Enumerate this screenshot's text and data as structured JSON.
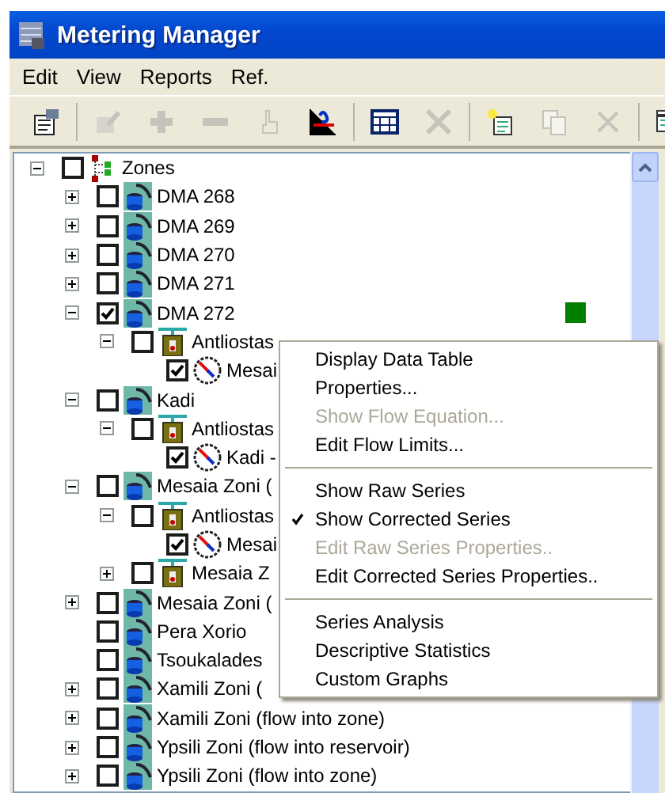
{
  "window": {
    "title": "Metering Manager"
  },
  "menu_bar": [
    {
      "label": "Edit"
    },
    {
      "label": "View"
    },
    {
      "label": "Reports"
    },
    {
      "label": "Ref."
    }
  ],
  "toolbar": {
    "groups": [
      [
        {
          "kind": "properties",
          "disabled": false
        }
      ],
      [
        {
          "kind": "edit-chart",
          "disabled": true
        },
        {
          "kind": "plus",
          "disabled": true
        },
        {
          "kind": "minus",
          "disabled": true
        },
        {
          "kind": "pointer",
          "disabled": true
        },
        {
          "kind": "chart-query",
          "disabled": false
        }
      ],
      [
        {
          "kind": "table",
          "disabled": false
        },
        {
          "kind": "cross-chart",
          "disabled": true
        }
      ],
      [
        {
          "kind": "new-sheet",
          "disabled": false
        },
        {
          "kind": "copy",
          "disabled": true
        },
        {
          "kind": "delete",
          "disabled": true
        }
      ],
      [
        {
          "kind": "calendar-globe",
          "disabled": false
        }
      ]
    ]
  },
  "tree": {
    "label": "Zones",
    "kind": "root",
    "checked": false,
    "expanded": true,
    "children": [
      {
        "label": "DMA 268",
        "kind": "zone",
        "checked": false,
        "expanded": false
      },
      {
        "label": "DMA 269",
        "kind": "zone",
        "checked": false,
        "expanded": false
      },
      {
        "label": "DMA 270",
        "kind": "zone",
        "checked": false,
        "expanded": false
      },
      {
        "label": "DMA 271",
        "kind": "zone",
        "checked": false,
        "expanded": false
      },
      {
        "label": "DMA 272",
        "kind": "zone",
        "checked": true,
        "expanded": true,
        "color": "#008000",
        "children": [
          {
            "label": "Antliostas",
            "kind": "station",
            "checked": false,
            "expanded": true,
            "children": [
              {
                "label": "Mesai",
                "kind": "meter",
                "checked": true
              }
            ]
          }
        ]
      },
      {
        "label": "Kadi",
        "kind": "zone",
        "checked": false,
        "expanded": true,
        "children": [
          {
            "label": "Antliostas",
            "kind": "station",
            "checked": false,
            "expanded": true,
            "children": [
              {
                "label": "Kadi -",
                "kind": "meter",
                "checked": true
              }
            ]
          }
        ]
      },
      {
        "label": "Mesaia Zoni (",
        "kind": "zone",
        "checked": false,
        "expanded": true,
        "children": [
          {
            "label": "Antliostas",
            "kind": "station",
            "checked": false,
            "expanded": true,
            "children": [
              {
                "label": "Mesai",
                "kind": "meter",
                "checked": true
              }
            ]
          },
          {
            "label": "Mesaia Z",
            "kind": "station",
            "checked": false,
            "expanded": false
          }
        ]
      },
      {
        "label": "Mesaia Zoni (",
        "kind": "zone",
        "checked": false,
        "expanded": false
      },
      {
        "label": "Pera Xorio",
        "kind": "zone",
        "checked": false
      },
      {
        "label": "Tsoukalades",
        "kind": "zone",
        "checked": false
      },
      {
        "label": "Xamili Zoni (",
        "kind": "zone",
        "checked": false,
        "expanded": false
      },
      {
        "label": "Xamili Zoni (flow into zone)",
        "kind": "zone",
        "checked": false,
        "expanded": false
      },
      {
        "label": "Ypsili Zoni (flow into reservoir)",
        "kind": "zone",
        "checked": false,
        "expanded": false
      },
      {
        "label": "Ypsili Zoni (flow into zone)",
        "kind": "zone",
        "checked": false,
        "expanded": false
      }
    ]
  },
  "context_menu": {
    "groups": [
      [
        {
          "label": "Display Data Table",
          "disabled": false,
          "checked": false
        },
        {
          "label": "Properties...",
          "disabled": false,
          "checked": false
        },
        {
          "label": "Show Flow Equation...",
          "disabled": true,
          "checked": false
        },
        {
          "label": "Edit Flow Limits...",
          "disabled": false,
          "checked": false
        }
      ],
      [
        {
          "label": "Show Raw Series",
          "disabled": false,
          "checked": false
        },
        {
          "label": "Show Corrected Series",
          "disabled": false,
          "checked": true
        },
        {
          "label": "Edit Raw Series Properties..",
          "disabled": true,
          "checked": false
        },
        {
          "label": "Edit Corrected Series Properties..",
          "disabled": false,
          "checked": false
        }
      ],
      [
        {
          "label": "Series Analysis",
          "disabled": false,
          "checked": false
        },
        {
          "label": "Descriptive Statistics",
          "disabled": false,
          "checked": false
        },
        {
          "label": "Custom Graphs",
          "disabled": false,
          "checked": false
        }
      ]
    ]
  }
}
